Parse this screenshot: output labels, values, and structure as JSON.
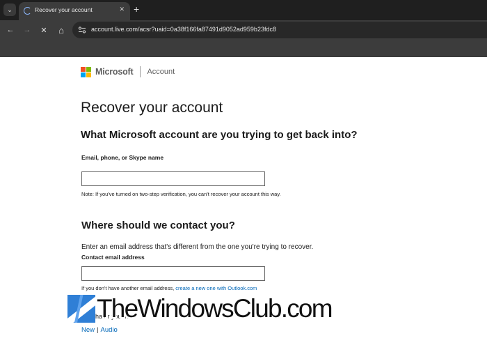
{
  "browser": {
    "tab": {
      "title": "Recover your account",
      "close_glyph": "✕"
    },
    "tab_menu_glyph": "⌄",
    "new_tab_glyph": "+",
    "nav": {
      "back_glyph": "←",
      "forward_glyph": "→",
      "stop_glyph": "✕",
      "home_glyph": "⌂"
    },
    "address_bar": {
      "url": "account.live.com/acsr?uaid=0a38f166fa87491d9052ad959b23fdc8"
    },
    "icons": [
      "chevron-down-icon",
      "loading-spinner-icon",
      "close-icon",
      "plus-icon",
      "arrow-left-icon",
      "arrow-right-icon",
      "stop-icon",
      "home-icon",
      "site-info-icon"
    ]
  },
  "header": {
    "brand": "Microsoft",
    "section": "Account",
    "logo_colors": [
      "#f25022",
      "#7fba00",
      "#00a4ef",
      "#ffb900"
    ]
  },
  "main": {
    "title": "Recover your account",
    "question": "What Microsoft account are you trying to get back into?",
    "account_field": {
      "label": "Email, phone, or Skype name",
      "value": "",
      "note": "Note: If you've turned on two-step verification, you can't recover your account this way."
    },
    "contact_section": {
      "heading": "Where should we contact you?",
      "description": "Enter an email address that's different from the one you're trying to recover.",
      "field_label": "Contact email address",
      "value": "",
      "help_text": "If you don't have another email address, ",
      "help_link": "create a new one with Outlook.com"
    },
    "captcha": {
      "hint_fragment": "r th  cha  t  r  you  se",
      "new_label": "New",
      "separator": "|",
      "audio_label": "Audio"
    }
  },
  "watermark": {
    "text": "TheWindowsClub.com"
  },
  "colors": {
    "link": "#0067b8",
    "chrome_dark": "#1f1f1f",
    "chrome_toolbar": "#3c3c3c",
    "spinner": "#8ab4f8"
  }
}
